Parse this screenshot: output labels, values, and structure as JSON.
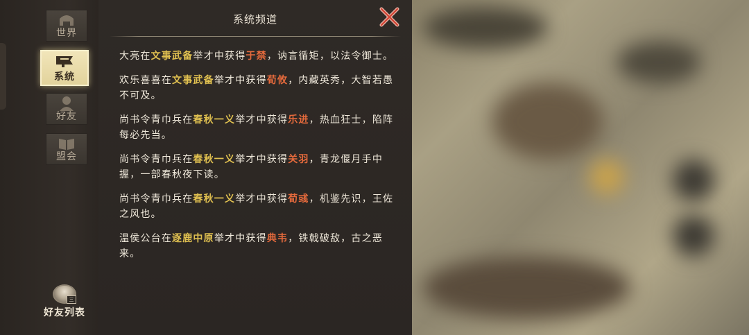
{
  "sidebar": {
    "tabs": [
      {
        "id": "world",
        "label": "世界",
        "icon": "helmet-icon"
      },
      {
        "id": "system",
        "label": "系统",
        "icon": "flag-icon"
      },
      {
        "id": "friends",
        "label": "好友",
        "icon": "warrior-icon"
      },
      {
        "id": "alliance",
        "label": "盟会",
        "icon": "book-icon"
      }
    ],
    "active": "system",
    "friend_list_label": "好友列表",
    "friend_badge": "三"
  },
  "panel": {
    "title": "系统频道",
    "close_icon": "close-x-icon"
  },
  "messages": [
    {
      "who": "大亮",
      "pre": "在",
      "event": "文事武备",
      "mid": "举才中获得",
      "hero": "于禁",
      "tail": "，讷言循矩，以法令御士。"
    },
    {
      "who": "欢乐喜喜",
      "pre": "在",
      "event": "文事武备",
      "mid": "举才中获得",
      "hero": "荀攸",
      "tail": "，内藏英秀，大智若愚不可及。"
    },
    {
      "who": "尚书令青巾兵",
      "pre": "在",
      "event": "春秋一义",
      "mid": "举才中获得",
      "hero": "乐进",
      "tail": "，热血狂士，陷阵每必先当。"
    },
    {
      "who": "尚书令青巾兵",
      "pre": "在",
      "event": "春秋一义",
      "mid": "举才中获得",
      "hero": "关羽",
      "tail": "，青龙偃月手中握，一部春秋夜下读。"
    },
    {
      "who": "尚书令青巾兵",
      "pre": "在",
      "event": "春秋一义",
      "mid": "举才中获得",
      "hero": "荀彧",
      "tail": "，机鉴先识，王佐之风也。"
    },
    {
      "who": "温侯公台",
      "pre": "在",
      "event": "逐鹿中原",
      "mid": "举才中获得",
      "hero": "典韦",
      "tail": "，铁戟破敌，古之恶来。"
    }
  ],
  "colors": {
    "event": "#e0c050",
    "hero": "#e56a3c",
    "text": "#efe8da"
  }
}
